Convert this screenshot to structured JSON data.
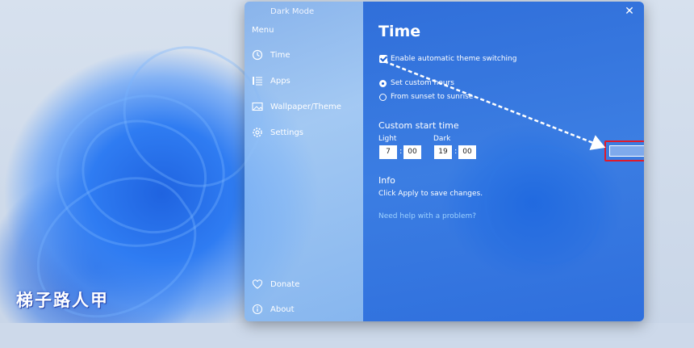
{
  "watermark": "梯子路人甲",
  "window": {
    "app_title": "Dark Mode",
    "close_glyph": "✕"
  },
  "sidebar": {
    "menu_label": "Menu",
    "items": [
      {
        "label": "Time",
        "icon": "clock-icon"
      },
      {
        "label": "Apps",
        "icon": "apps-list-icon"
      },
      {
        "label": "Wallpaper/Theme",
        "icon": "wallpaper-icon"
      },
      {
        "label": "Settings",
        "icon": "gear-icon"
      }
    ],
    "bottom_items": [
      {
        "label": "Donate",
        "icon": "heart-icon"
      },
      {
        "label": "About",
        "icon": "info-icon"
      }
    ]
  },
  "main": {
    "title": "Time",
    "auto_switch_label": "Enable automatic theme switching",
    "auto_switch_checked": true,
    "radio_custom_label": "Set custom hours",
    "radio_sunset_label": "From sunset to sunrise",
    "selected_mode": "custom",
    "custom_start_title": "Custom start time",
    "light_label": "Light",
    "dark_label": "Dark",
    "light_hour": "7",
    "light_minute": "00",
    "dark_hour": "19",
    "dark_minute": "00",
    "colon": ":",
    "info_title": "Info",
    "info_text": "Click Apply to save changes.",
    "help_link": "Need help with a problem?"
  },
  "colors": {
    "accent": "#1a5fd6",
    "highlight": "#e01a2a",
    "link": "#9ed2ff"
  }
}
